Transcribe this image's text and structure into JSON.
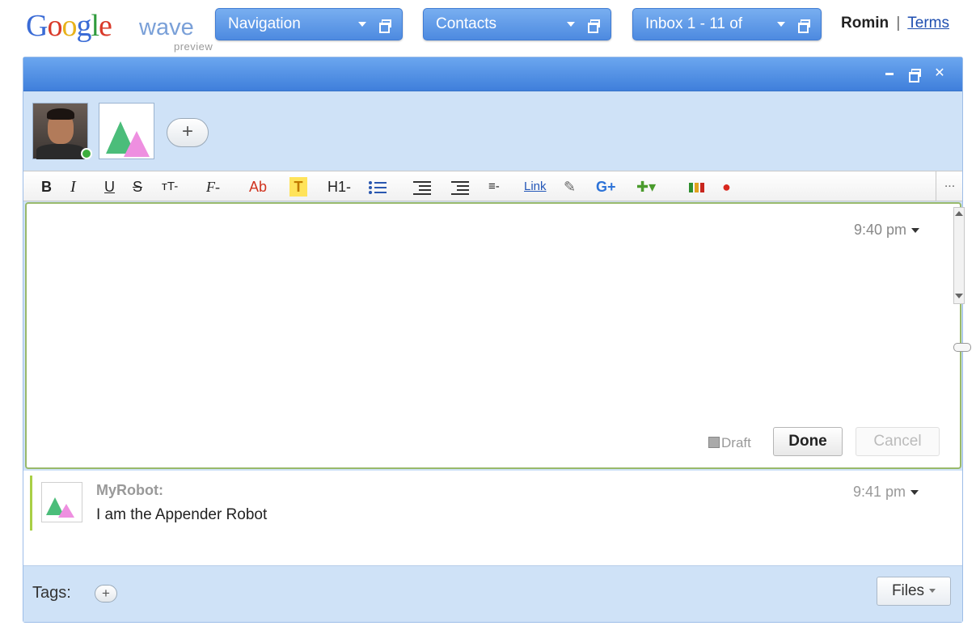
{
  "logo": {
    "google_letters": [
      "G",
      "o",
      "o",
      "g",
      "l",
      "e"
    ],
    "wave": "wave",
    "preview": "preview"
  },
  "top_panels": {
    "navigation": "Navigation",
    "contacts": "Contacts",
    "inbox": "Inbox 1 - 11 of"
  },
  "user": {
    "name": "Romin",
    "separator": "|",
    "terms": "Terms"
  },
  "participants": {
    "add_label": "+"
  },
  "toolbar": {
    "bold": "B",
    "italic": "I",
    "underline": "U",
    "strike": "S",
    "size": "тT-",
    "font": "F-",
    "color": "Ab",
    "highlight": "T",
    "heading": "H1-",
    "align": "≡-",
    "link": "Link",
    "gadget_add": "G+",
    "more": "..."
  },
  "editor": {
    "time": "9:40 pm",
    "draft_label": "Draft",
    "done_label": "Done",
    "cancel_label": "Cancel"
  },
  "blip": {
    "author": "MyRobot:",
    "text": "I am the Appender Robot",
    "time": "9:41 pm"
  },
  "footer": {
    "tags_label": "Tags:",
    "tags_add": "+",
    "files_label": "Files"
  },
  "colors": {
    "panel_blue": "#4d8ae0",
    "panel_bg": "#cfe2f7",
    "editor_border": "#99b96a",
    "blip_bar": "#a9cf45",
    "online": "#3cae3c"
  }
}
